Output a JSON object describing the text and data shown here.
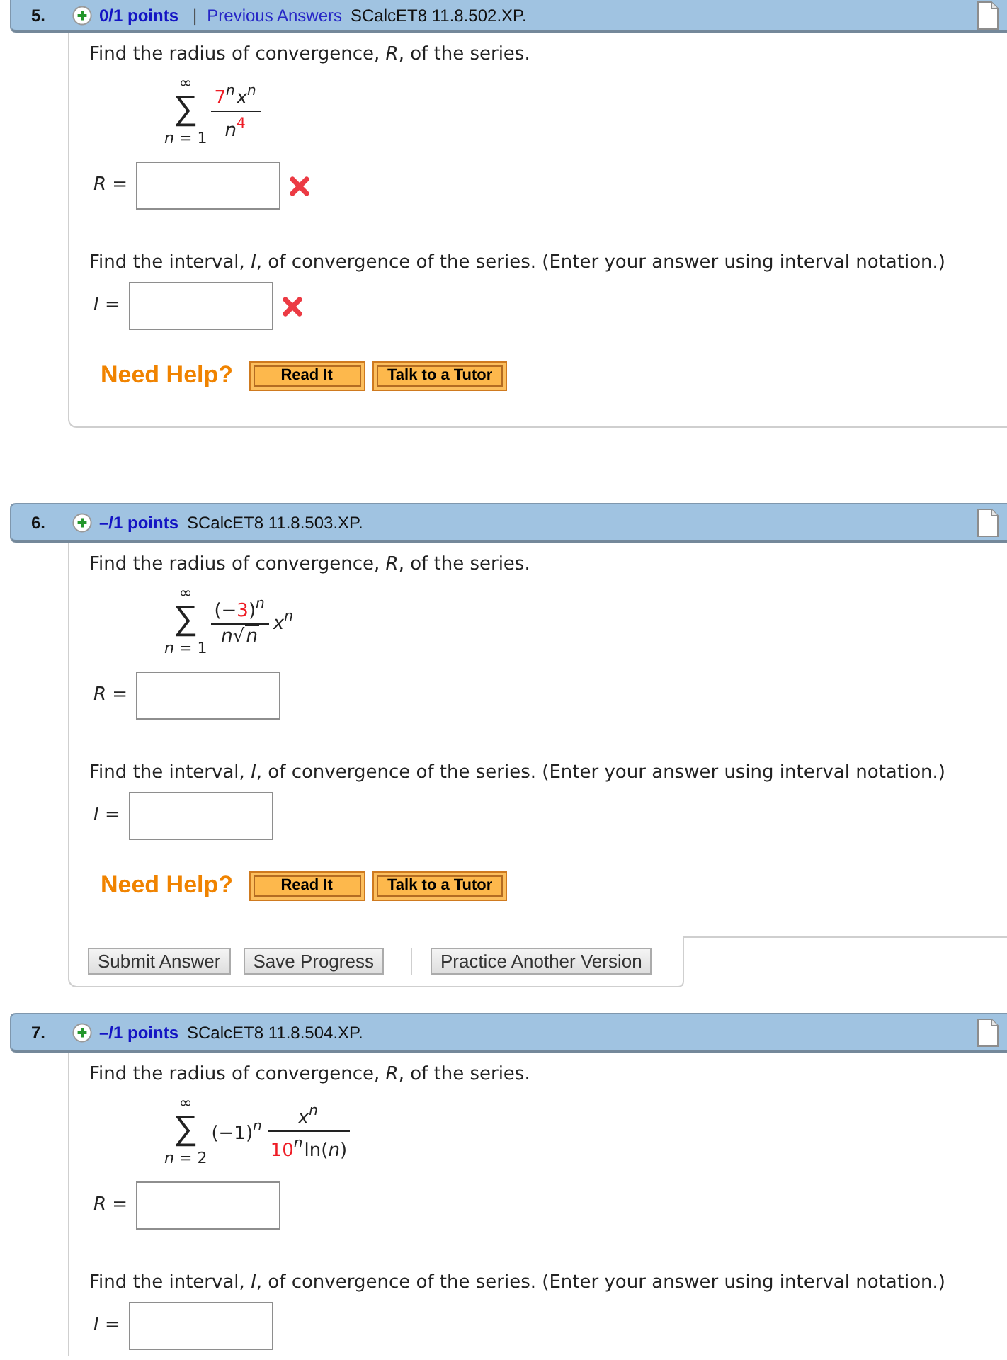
{
  "questions": [
    {
      "number": "5.",
      "points": "0/1 points",
      "separator": "|",
      "link": "Previous Answers",
      "code": "SCalcET8 11.8.502.XP.",
      "radius_prompt": "Find the radius of convergence, *R*, of the series.",
      "series": {
        "upper": "∞",
        "operator": "∑",
        "lower": "*n* = 1",
        "terms": [
          {
            "kind": "fraction",
            "numerator": [
              {
                "text": "7",
                "kind": "upright",
                "highlighted": true
              },
              {
                "text": "n",
                "kind": "sup-italic",
                "highlighted": false
              },
              {
                "text": "x",
                "kind": "italic",
                "highlighted": false
              },
              {
                "text": "n",
                "kind": "sup-italic",
                "highlighted": false
              }
            ],
            "denominator": [
              {
                "text": "n",
                "kind": "italic",
                "highlighted": false
              },
              {
                "text": "4",
                "kind": "sup-upright",
                "highlighted": true
              }
            ]
          }
        ]
      },
      "radius_field": {
        "label": "*R* =",
        "incorrect": true
      },
      "interval_prompt": "Find the interval, *I*, of convergence of the series. (Enter your answer using interval notation.)",
      "interval_field": {
        "label": "*I* =",
        "incorrect": true
      },
      "help": {
        "label": "Need Help?",
        "buttons": [
          "Read It",
          "Talk to a Tutor"
        ]
      }
    },
    {
      "number": "6.",
      "points": "–/1 points",
      "code": "SCalcET8 11.8.503.XP.",
      "radius_prompt": "Find the radius of convergence, *R*, of the series.",
      "series": {
        "upper": "∞",
        "operator": "∑",
        "lower": "*n* = 1",
        "terms": [
          {
            "kind": "fraction",
            "numerator": [
              {
                "text": "(−",
                "kind": "upright",
                "highlighted": false
              },
              {
                "text": "3",
                "kind": "upright",
                "highlighted": true
              },
              {
                "text": ")",
                "kind": "upright",
                "highlighted": false
              },
              {
                "text": "n",
                "kind": "sup-italic",
                "highlighted": false
              }
            ],
            "denominator": [
              {
                "text": "n",
                "kind": "italic",
                "highlighted": false
              },
              {
                "text": "√",
                "kind": "radical",
                "highlighted": false
              },
              {
                "text": "n",
                "kind": "radicand",
                "highlighted": false
              }
            ]
          },
          {
            "kind": "factor",
            "tokens": [
              {
                "text": "x",
                "kind": "italic",
                "highlighted": false
              },
              {
                "text": "n",
                "kind": "sup-italic",
                "highlighted": false
              }
            ]
          }
        ]
      },
      "radius_field": {
        "label": "*R* =",
        "incorrect": false
      },
      "interval_prompt": "Find the interval, *I*, of convergence of the series. (Enter your answer using interval notation.)",
      "interval_field": {
        "label": "*I* =",
        "incorrect": false
      },
      "help": {
        "label": "Need Help?",
        "buttons": [
          "Read It",
          "Talk to a Tutor"
        ]
      },
      "action_groups": [
        [
          "Submit Answer",
          "Save Progress"
        ],
        [
          "Practice Another Version"
        ]
      ]
    },
    {
      "number": "7.",
      "points": "–/1 points",
      "code": "SCalcET8 11.8.504.XP.",
      "radius_prompt": "Find the radius of convergence, *R*, of the series.",
      "series": {
        "upper": "∞",
        "operator": "∑",
        "lower": "*n* = 2",
        "terms": [
          {
            "kind": "factor",
            "tokens": [
              {
                "text": "(−1)",
                "kind": "upright",
                "highlighted": false
              },
              {
                "text": "n",
                "kind": "sup-italic",
                "highlighted": false
              }
            ]
          },
          {
            "kind": "fraction",
            "numerator": [
              {
                "text": "x",
                "kind": "italic",
                "highlighted": false
              },
              {
                "text": "n",
                "kind": "sup-italic",
                "highlighted": false
              }
            ],
            "denominator": [
              {
                "text": "10",
                "kind": "upright",
                "highlighted": true
              },
              {
                "text": "n",
                "kind": "sup-italic",
                "highlighted": false
              },
              {
                "text": "ln(",
                "kind": "upright",
                "highlighted": false
              },
              {
                "text": "n",
                "kind": "italic",
                "highlighted": false
              },
              {
                "text": ")",
                "kind": "upright",
                "highlighted": false
              }
            ]
          }
        ]
      },
      "radius_field": {
        "label": "*R* =",
        "incorrect": false
      },
      "interval_prompt": "Find the interval, *I*, of convergence of the series. (Enter your answer using interval notation.)",
      "interval_field": {
        "label": "*I* =",
        "incorrect": false
      }
    }
  ]
}
